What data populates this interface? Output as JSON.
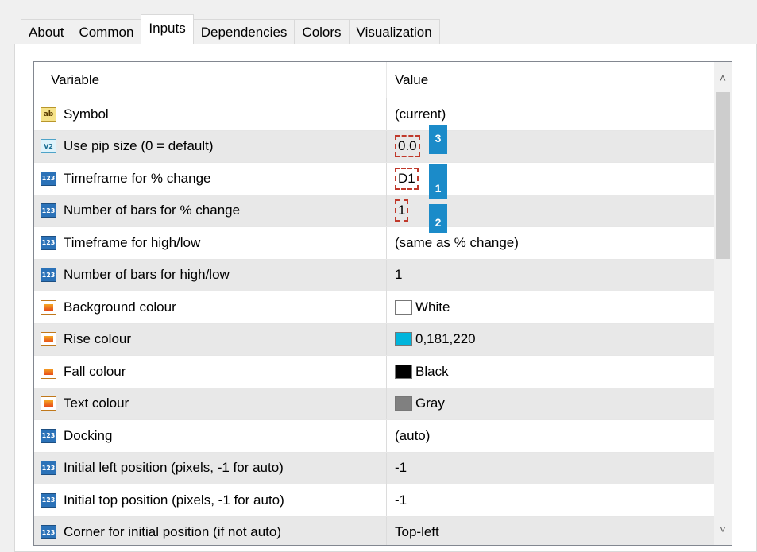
{
  "tabs": [
    "About",
    "Common",
    "Inputs",
    "Dependencies",
    "Colors",
    "Visualization"
  ],
  "table": {
    "headers": [
      "Variable",
      "Value"
    ],
    "rows": [
      {
        "icon": "ab",
        "label": "Symbol",
        "value": "(current)"
      },
      {
        "icon": "v2",
        "label": "Use pip size (0 = default)",
        "value": "0.0"
      },
      {
        "icon": "n123",
        "label": "Timeframe for % change",
        "value": "D1"
      },
      {
        "icon": "n123",
        "label": "Number of bars for % change",
        "value": "1"
      },
      {
        "icon": "n123",
        "label": "Timeframe for high/low",
        "value": "(same as % change)"
      },
      {
        "icon": "n123",
        "label": "Number of bars for high/low",
        "value": "1"
      },
      {
        "icon": "col",
        "label": "Background colour",
        "value": "White",
        "swatch": "#ffffff"
      },
      {
        "icon": "col",
        "label": "Rise colour",
        "value": "0,181,220",
        "swatch": "#00b5dc"
      },
      {
        "icon": "col",
        "label": "Fall colour",
        "value": "Black",
        "swatch": "#000000"
      },
      {
        "icon": "col",
        "label": "Text colour",
        "value": "Gray",
        "swatch": "#808080"
      },
      {
        "icon": "n123",
        "label": "Docking",
        "value": "(auto)"
      },
      {
        "icon": "n123",
        "label": "Initial left position (pixels, -1 for auto)",
        "value": "-1"
      },
      {
        "icon": "n123",
        "label": "Initial top position (pixels, -1 for auto)",
        "value": "-1"
      },
      {
        "icon": "n123",
        "label": "Corner for initial position (if not auto)",
        "value": "Top-left"
      }
    ]
  },
  "icon_text": {
    "ab": "ab",
    "v2": "V2",
    "n123": "123"
  },
  "annotations": [
    {
      "number": "3"
    },
    {
      "number": "1"
    },
    {
      "number": "2"
    }
  ]
}
